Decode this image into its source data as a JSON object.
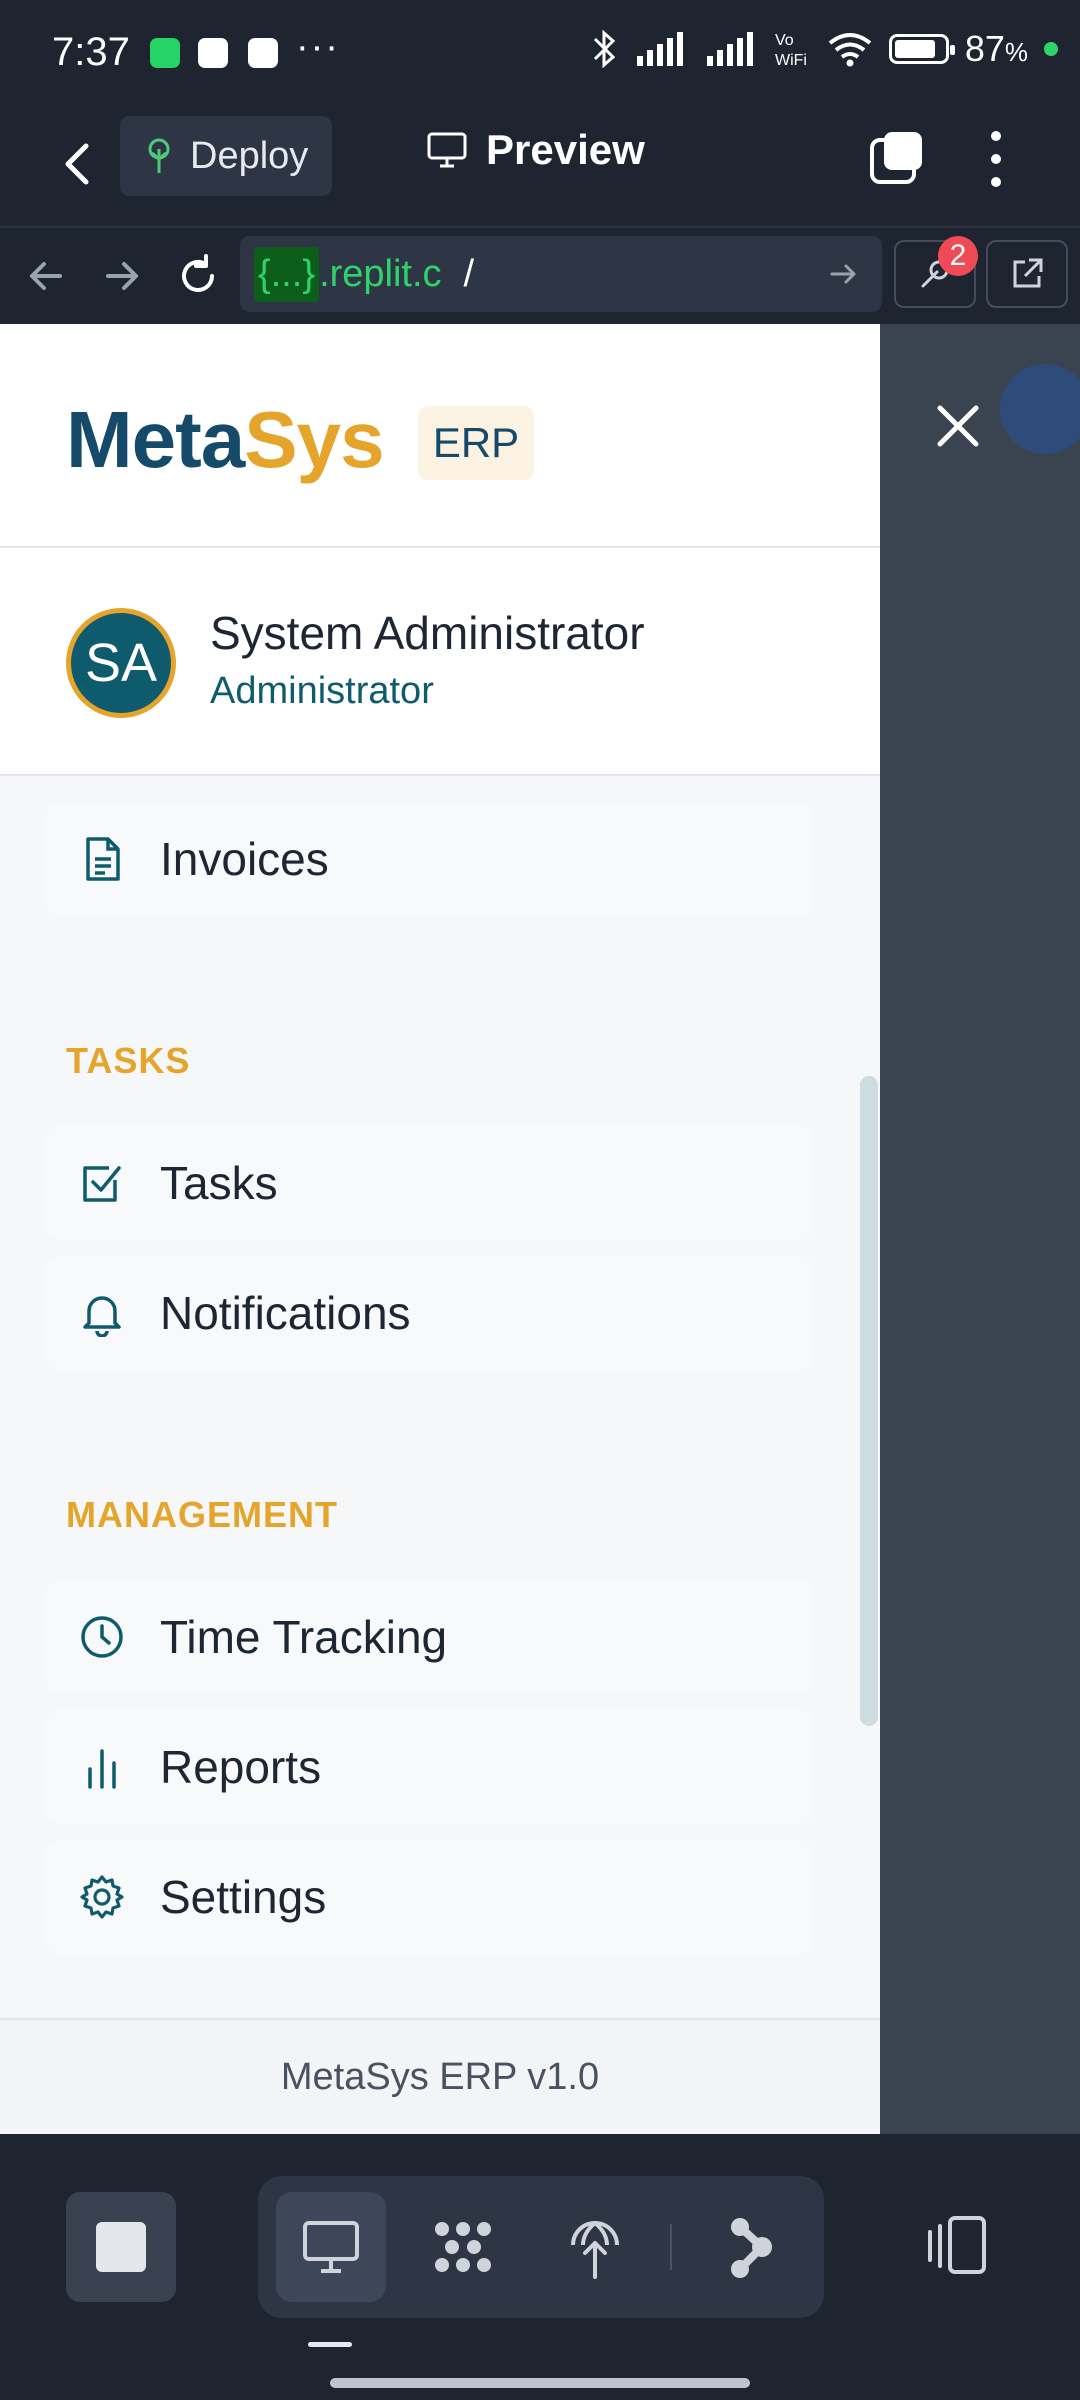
{
  "status_bar": {
    "time": "7:37",
    "more": "···",
    "battery": "87",
    "battery_unit": "%"
  },
  "app_bar": {
    "deploy_label": "Deploy",
    "preview_label": "Preview"
  },
  "url_bar": {
    "host_highlight": "{...}",
    "host_rest": ".replit.c",
    "path": "/",
    "badge_count": "2"
  },
  "drawer": {
    "brand_meta": "Meta",
    "brand_sys": "Sys",
    "brand_badge": "ERP",
    "user": {
      "initials": "SA",
      "name": "System Administrator",
      "role": "Administrator"
    },
    "items": [
      {
        "label": "Invoices",
        "icon": "document-icon"
      },
      {
        "label": "Tasks",
        "icon": "checkbox-icon"
      },
      {
        "label": "Notifications",
        "icon": "bell-icon"
      },
      {
        "label": "Time Tracking",
        "icon": "clock-icon"
      },
      {
        "label": "Reports",
        "icon": "bar-chart-icon"
      },
      {
        "label": "Settings",
        "icon": "gear-icon"
      }
    ],
    "sections": {
      "tasks": "TASKS",
      "management": "MANAGEMENT"
    },
    "footer": "MetaSys ERP v1.0"
  },
  "colors": {
    "brand_dark": "#154a6b",
    "brand_accent": "#e5a52c",
    "teal": "#0f5b6e",
    "repl_green": "#2fd36b"
  }
}
